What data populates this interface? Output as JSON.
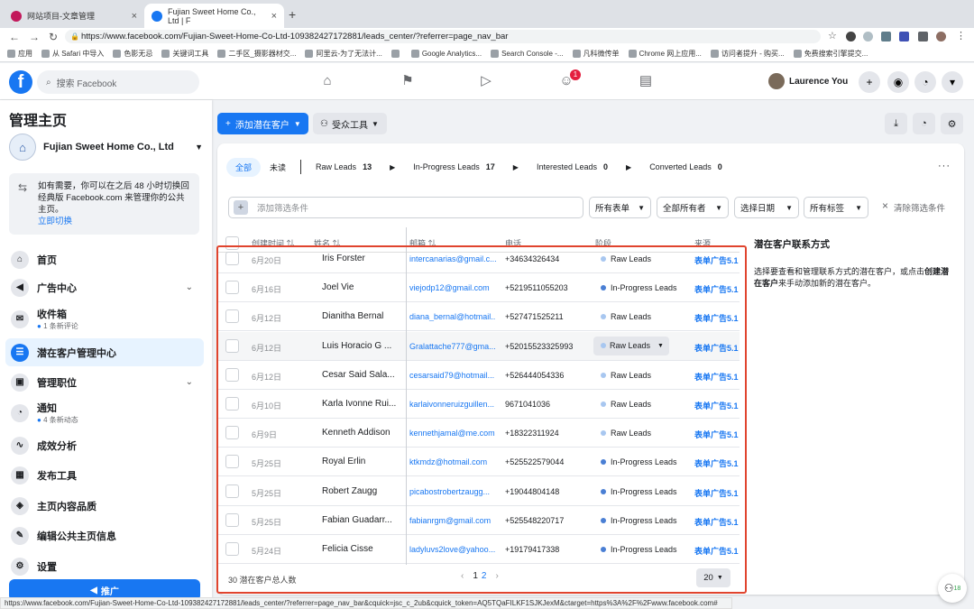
{
  "browser": {
    "tabs": [
      {
        "title": "网站项目-文章管理",
        "favicon_color": "#c2185b"
      },
      {
        "title": "Fujian Sweet Home Co., Ltd | F",
        "favicon_color": "#1877f2"
      }
    ],
    "new_tab": "+",
    "url": "https://www.facebook.com/Fujian-Sweet-Home-Co-Ltd-109382427172881/leads_center/?referrer=page_nav_bar",
    "bookmarks": [
      "应用",
      "从 Safari 中导入",
      "色影无忌",
      "关键词工具",
      "二手区_摄影器材交...",
      "阿里云-为了无法计...",
      "",
      "Google Analytics...",
      "Search Console -...",
      "凡科微传单",
      "Chrome 网上应用...",
      "访问者提升 - 购买...",
      "免费搜索引擎提交..."
    ],
    "status_url": "https://www.facebook.com/Fujian-Sweet-Home-Co-Ltd-109382427172881/leads_center/?referrer=page_nav_bar&cquick=jsc_c_2ub&cquick_token=AQ5TQaFILKF1SJKJexM&ctarget=https%3A%2F%2Fwww.facebook.com#"
  },
  "fb_header": {
    "search_placeholder": "搜索 Facebook",
    "notification_badge": "1",
    "user_name": "Laurence You"
  },
  "sidebar": {
    "title": "管理主页",
    "page_name": "Fujian Sweet Home Co., Ltd",
    "switch_text": "如有需要，你可以在之后 48 小时切换回经典版 Facebook.com 来管理你的公共主页。",
    "switch_link": "立即切换",
    "items": [
      {
        "label": "首页",
        "icon": "home-icon",
        "glyph": "⌂"
      },
      {
        "label": "广告中心",
        "icon": "megaphone-icon",
        "glyph": "◀",
        "chevron": "⌄"
      },
      {
        "label": "收件箱",
        "icon": "inbox-icon",
        "glyph": "✉",
        "sub": "1 条新评论"
      },
      {
        "label": "潜在客户管理中心",
        "icon": "leads-center-icon",
        "glyph": "☰"
      },
      {
        "label": "管理职位",
        "icon": "briefcase-icon",
        "glyph": "▣",
        "chevron": "⌄"
      },
      {
        "label": "通知",
        "icon": "bell-icon",
        "glyph": "◔",
        "sub": "4 条新动态"
      },
      {
        "label": "成效分析",
        "icon": "insights-icon",
        "glyph": "∿"
      },
      {
        "label": "发布工具",
        "icon": "publishing-tools-icon",
        "glyph": "▦"
      },
      {
        "label": "主页内容品质",
        "icon": "shield-icon",
        "glyph": "◈"
      },
      {
        "label": "编辑公共主页信息",
        "icon": "pencil-icon",
        "glyph": "✎"
      },
      {
        "label": "设置",
        "icon": "gear-icon",
        "glyph": "⚙"
      }
    ],
    "promote": "推广"
  },
  "toolbar": {
    "add_lead": "添加潜在客户",
    "audience_tool": "受众工具"
  },
  "lead_tabs": {
    "all": "全部",
    "unread": "未读",
    "stages": [
      {
        "label": "Raw Leads",
        "count": "13"
      },
      {
        "label": "In-Progress Leads",
        "count": "17"
      },
      {
        "label": "Interested Leads",
        "count": "0"
      },
      {
        "label": "Converted Leads",
        "count": "0"
      }
    ]
  },
  "filters": {
    "add_filter_placeholder": "添加筛选条件",
    "all_forms": "所有表单",
    "all_owners": "全部所有者",
    "select_date": "选择日期",
    "all_tags": "所有标签",
    "clear": "清除筛选条件"
  },
  "table": {
    "headers": [
      "创建时间 ⇅",
      "姓名 ⇅",
      "邮箱 ⇅",
      "电话",
      "阶段",
      "来源"
    ],
    "rows": [
      {
        "date": "6月20日",
        "name": "Iris Forster",
        "email": "intercanarias@gmail.c...",
        "phone": "+34634326434",
        "stage": "Raw Leads",
        "source": "表单广告5.1"
      },
      {
        "date": "6月16日",
        "name": "Joel Vie",
        "email": "viejodp12@gmail.com",
        "phone": "+5219511055203",
        "stage": "In-Progress Leads",
        "source": "表单广告5.1"
      },
      {
        "date": "6月12日",
        "name": "Dianitha Bernal",
        "email": "diana_bernal@hotmail...",
        "phone": "+527471525211",
        "stage": "Raw Leads",
        "source": "表单广告5.1"
      },
      {
        "date": "6月12日",
        "name": "Luis Horacio G ...",
        "email": "Gralattache777@gma...",
        "phone": "+52015523325993",
        "stage": "Raw Leads",
        "source": "表单广告5.1"
      },
      {
        "date": "6月12日",
        "name": "Cesar Said Sala...",
        "email": "cesarsaid79@hotmail...",
        "phone": "+526444054336",
        "stage": "Raw Leads",
        "source": "表单广告5.1"
      },
      {
        "date": "6月10日",
        "name": "Karla Ivonne Rui...",
        "email": "karlaivonneruizguillen...",
        "phone": "9671041036",
        "stage": "Raw Leads",
        "source": "表单广告5.1"
      },
      {
        "date": "6月9日",
        "name": "Kenneth Addison",
        "email": "kennethjamal@me.com",
        "phone": "+18322311924",
        "stage": "Raw Leads",
        "source": "表单广告5.1"
      },
      {
        "date": "5月25日",
        "name": "Royal Erlin",
        "email": "ktkmdz@hotmail.com",
        "phone": "+525522579044",
        "stage": "In-Progress Leads",
        "source": "表单广告5.1"
      },
      {
        "date": "5月25日",
        "name": "Robert Zaugg",
        "email": "picabostrobertzaugg...",
        "phone": "+19044804148",
        "stage": "In-Progress Leads",
        "source": "表单广告5.1"
      },
      {
        "date": "5月25日",
        "name": "Fabian Guadarr...",
        "email": "fabianrgm@gmail.com",
        "phone": "+525548220717",
        "stage": "In-Progress Leads",
        "source": "表单广告5.1"
      },
      {
        "date": "5月24日",
        "name": "Felicia Cisse",
        "email": "ladyluvs2love@yahoo....",
        "phone": "+19179417338",
        "stage": "In-Progress Leads",
        "source": "表单广告5.1"
      }
    ],
    "total": "30 潜在客户总人数",
    "pages": [
      "1",
      "2"
    ],
    "per_page": "20"
  },
  "right_panel": {
    "title": "潜在客户联系方式",
    "text_before": "选择要查看和管理联系方式的潜在客户，或点击",
    "text_bold": "创建潜在客户",
    "text_after": "来手动添加新的潜在客户。"
  },
  "chat_badge": "18",
  "colors": {
    "brand": "#1877f2",
    "raw_dot": "#a8c7f0",
    "progress_dot": "#4a7fd4",
    "highlight_border": "#e0442e"
  }
}
